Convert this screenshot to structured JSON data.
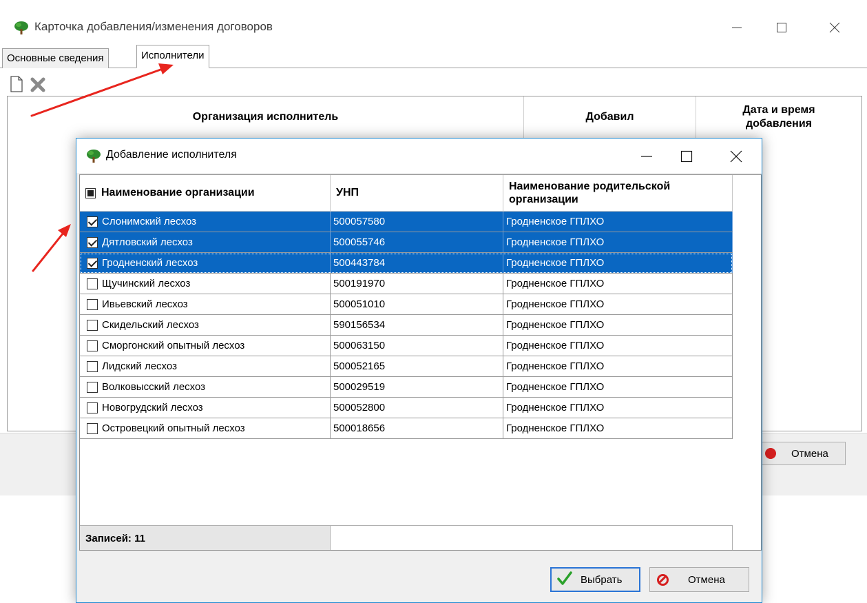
{
  "outer_window": {
    "title": "Карточка добавления/изменения договоров",
    "tabs": [
      {
        "label": "Основные сведения",
        "active": false
      },
      {
        "label": "Исполнители",
        "active": true
      }
    ],
    "toolbar": [
      "new-document-icon",
      "delete-icon"
    ],
    "grid_headers": [
      "Организация исполнитель",
      "Добавил",
      "Дата и время добавления"
    ],
    "cancel_label": "Отмена"
  },
  "dialog": {
    "title": "Добавление исполнителя",
    "columns": {
      "name": "Наименование организации",
      "unp": "УНП",
      "parent": "Наименование родительской организации"
    },
    "rows": [
      {
        "checked": true,
        "selected": true,
        "name": "Слонимский лесхоз",
        "unp": "500057580",
        "parent": "Гродненское ГПЛХО"
      },
      {
        "checked": true,
        "selected": true,
        "name": "Дятловский лесхоз",
        "unp": "500055746",
        "parent": "Гродненское ГПЛХО"
      },
      {
        "checked": true,
        "selected": true,
        "name": "Гродненский лесхоз",
        "unp": "500443784",
        "parent": "Гродненское ГПЛХО"
      },
      {
        "checked": false,
        "selected": false,
        "name": "Щучинский лесхоз",
        "unp": "500191970",
        "parent": "Гродненское ГПЛХО"
      },
      {
        "checked": false,
        "selected": false,
        "name": "Ивьевский лесхоз",
        "unp": "500051010",
        "parent": "Гродненское ГПЛХО"
      },
      {
        "checked": false,
        "selected": false,
        "name": "Скидельский лесхоз",
        "unp": "590156534",
        "parent": "Гродненское ГПЛХО"
      },
      {
        "checked": false,
        "selected": false,
        "name": "Сморгонский опытный лесхоз",
        "unp": "500063150",
        "parent": "Гродненское ГПЛХО"
      },
      {
        "checked": false,
        "selected": false,
        "name": "Лидский лесхоз",
        "unp": "500052165",
        "parent": "Гродненское ГПЛХО"
      },
      {
        "checked": false,
        "selected": false,
        "name": "Волковысский лесхоз",
        "unp": "500029519",
        "parent": "Гродненское ГПЛХО"
      },
      {
        "checked": false,
        "selected": false,
        "name": "Новогрудский лесхоз",
        "unp": "500052800",
        "parent": "Гродненское ГПЛХО"
      },
      {
        "checked": false,
        "selected": false,
        "name": "Островецкий опытный лесхоз",
        "unp": "500018656",
        "parent": "Гродненское ГПЛХО"
      }
    ],
    "footer_count": "Записей: 11",
    "select_label": "Выбрать",
    "cancel_label": "Отмена"
  },
  "colors": {
    "selection": "#0a67c2",
    "dialog_border": "#1f8ad2",
    "annotation_arrow": "#e8251e"
  }
}
